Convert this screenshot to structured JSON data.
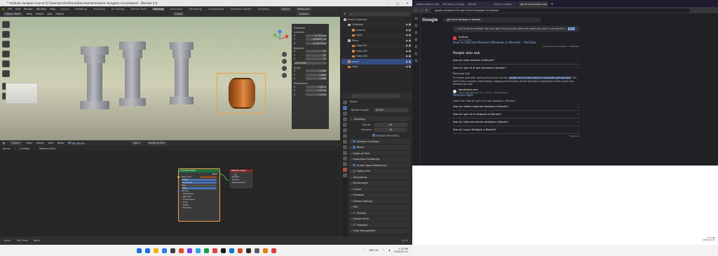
{
  "blender": {
    "title": "* modular dungeon course [C:\\Users\\pc\\OneDrive\\Documents\\modular dungeon course\\base] - Blender 4.0",
    "menu": [
      "File",
      "Edit",
      "Render",
      "Window",
      "Help"
    ],
    "workspaces": [
      "Layout",
      "Modeling",
      "Sculpting",
      "UV Editing",
      "Texture Paint",
      "Shading",
      "Animation",
      "Rendering",
      "Compositing",
      "Geometry Nodes",
      "Scripting"
    ],
    "active_workspace": "Shading",
    "scene": "Scene",
    "view_layer": "ViewLayer",
    "viewport_header": {
      "mode": "Object Mode",
      "view": "View",
      "select": "Select",
      "add": "Add",
      "object": "Object",
      "orientation": "Global",
      "options": "Options"
    },
    "n_panel": {
      "transform": "Transform",
      "location": "Location:",
      "loc": [
        {
          "axis": "X",
          "value": "3.7574 m"
        },
        {
          "axis": "Y",
          "value": "-0.80917 m"
        },
        {
          "axis": "Z",
          "value": "0.22078 m"
        }
      ],
      "rotation": "Rotation:",
      "rot": [
        {
          "axis": "X",
          "value": "0°"
        },
        {
          "axis": "Y",
          "value": "0°"
        },
        {
          "axis": "Z",
          "value": "0°"
        }
      ],
      "rot_mode": "XYZ Euler",
      "scale": "Scale:",
      "scl": [
        {
          "axis": "X",
          "value": "1.000"
        },
        {
          "axis": "Y",
          "value": "1.000"
        },
        {
          "axis": "Z",
          "value": "1.000"
        }
      ],
      "dimensions": "Dimensions:",
      "dim": [
        {
          "axis": "X",
          "value": "1.26 m"
        },
        {
          "axis": "Y",
          "value": "1.27 m"
        },
        {
          "axis": "Z",
          "value": "1.2 m"
        }
      ]
    },
    "node_header": {
      "object": "Object",
      "view": "View",
      "select": "Select",
      "add": "Add",
      "node": "Node",
      "use_nodes": "Use Nodes",
      "slot": "Slot 1",
      "material": "Material.004"
    },
    "breadcrumb": [
      "barrel",
      "Cylinder",
      "Material.004"
    ],
    "bsdf_node": {
      "title": "Principled BSDF",
      "out": "BSDF",
      "rows": [
        "Base Color",
        "Metallic",
        "Roughness",
        "IOR",
        "Alpha",
        "Normal",
        "Subsurface",
        "Specular",
        "Transmission",
        "Coat",
        "Sheen",
        "Emission"
      ]
    },
    "output_node": {
      "title": "Material Output",
      "target": "All",
      "rows": [
        "Surface",
        "Volume",
        "Displacement"
      ]
    },
    "outliner": {
      "header": "Scene Collection",
      "rows": [
        {
          "label": "Scene Collection",
          "indent": 0,
          "color": "#bbbbbb"
        },
        {
          "label": "Collection",
          "indent": 1,
          "color": "#bbbbbb"
        },
        {
          "label": "Camera",
          "indent": 2,
          "color": "#d98a47"
        },
        {
          "label": "Light",
          "indent": 2,
          "color": "#d98a47"
        },
        {
          "label": "Pillars",
          "indent": 1,
          "color": "#bbbbbb"
        },
        {
          "label": "Cube.001",
          "indent": 2,
          "color": "#d98a47"
        },
        {
          "label": "Cube.002",
          "indent": 2,
          "color": "#d98a47"
        },
        {
          "label": "Cube.003",
          "indent": 2,
          "color": "#d98a47"
        },
        {
          "label": "barrel",
          "indent": 1,
          "color": "#d98a47"
        },
        {
          "label": "crate",
          "indent": 1,
          "color": "#d98a47"
        }
      ]
    },
    "properties": {
      "scene": "Scene",
      "render_engine_label": "Render Engine",
      "render_engine": "EEVEE",
      "sampling": "Sampling",
      "render_label": "Render",
      "render_value": "64",
      "viewport_label": "Viewport",
      "viewport_value": "16",
      "viewport_denoising": "Viewport Denoising",
      "sections": [
        {
          "label": "Ambient Occlusion",
          "check": true
        },
        {
          "label": "Bloom",
          "check": true
        },
        {
          "label": "Depth of Field",
          "check": null
        },
        {
          "label": "Subsurface Scattering",
          "check": null
        },
        {
          "label": "Screen Space Reflections",
          "check": true
        },
        {
          "label": "Motion Blur",
          "check": false
        },
        {
          "label": "Volumetrics",
          "check": null
        },
        {
          "label": "Performance",
          "check": null
        },
        {
          "label": "Curves",
          "check": null
        },
        {
          "label": "Shadows",
          "check": null
        },
        {
          "label": "Indirect Lighting",
          "check": null
        },
        {
          "label": "Film",
          "check": null
        },
        {
          "label": "Simplify",
          "check": false
        },
        {
          "label": "Grease Pencil",
          "check": null
        },
        {
          "label": "Freestyle",
          "check": false
        },
        {
          "label": "Color Management",
          "check": null
        }
      ]
    },
    "status": [
      "Select",
      "Pan View",
      "Node"
    ],
    "version": "4.0.2"
  },
  "taskbar": {
    "time": "1:15 PM",
    "date": "2024-02-01",
    "lang": "ENG US",
    "icons": [
      "#1e6fd9",
      "#f3b400",
      "#2b7de9",
      "#3c3c3c",
      "#e44d26",
      "#7b3fe4",
      "#2aa5e2",
      "#1c9e4b",
      "#e04343",
      "#1b1b1b",
      "#0078d4",
      "#d34f22",
      "#2b2b2b",
      "#5a5a5a",
      "#e87d0d",
      "#e23b3b"
    ]
  },
  "chrome": {
    "tabs": [
      "Getting Started | Inkscape",
      "Free Search - Google",
      "Blender",
      "Unity on Ubuntu",
      "get rid of windows in blender - Go"
    ],
    "active_tab": 4,
    "url": "google.com/search?q=get+rid+of+windows+in+blender",
    "search": "get rid of windows in blender",
    "google": "Google",
    "snippet_top": "... And it will be deleted. You can right click and join areas the same way. And if you want to ...",
    "more": "More",
    "yt_source": "YouTube",
    "yt_date": "Jun 11, 2021",
    "yt_title": "How to Add and Remove Windows in Blender - YouTube",
    "yt_meta": "About featured snippets • Feedback",
    "paa_title": "People also ask",
    "paa": [
      "How do I hide windows in Blender?",
      "How do I get rid of split windows in Blender?"
    ],
    "answer_heading": "Removing Split",
    "answer_pre": "To remove split after splitting the screen into two, ",
    "answer_hl": "double-click on the vertical or horizontal split boundary",
    "answer_post": ". The split is then removed. Alternatively, dragging the boundary to the left/right or top/bottom of the screen also removes the split.",
    "ans_source": "blenderbase.com",
    "ans_url": "https://blenderbase.com › library › blenderbase-...",
    "ans_title": "Remove Split",
    "search_for": "Search for: How do I get rid of split windows in Blender?",
    "paa2": [
      "How do I delete duplicate windows in Blender?",
      "How do I get rid of viewports in Blender?",
      "How do I add and remove windows in Blender?",
      "How do I move Windows in Blender?"
    ],
    "feedback": "Feedback"
  },
  "right_clock": {
    "time": "1:15 PM",
    "date": "2024-02-01"
  }
}
